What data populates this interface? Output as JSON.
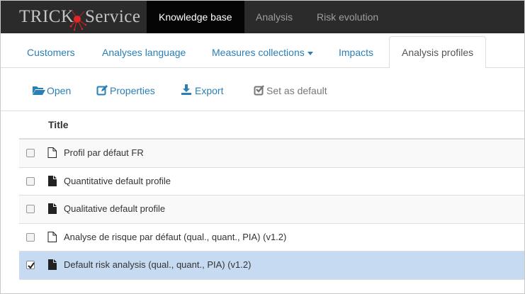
{
  "brand": {
    "name_part1": "TRICK",
    "name_part2": "Service"
  },
  "navbar": {
    "items": [
      {
        "label": "Knowledge base",
        "active": true
      },
      {
        "label": "Analysis",
        "active": false
      },
      {
        "label": "Risk evolution",
        "active": false
      }
    ]
  },
  "tabs": [
    {
      "label": "Customers"
    },
    {
      "label": "Analyses language"
    },
    {
      "label": "Measures collections"
    },
    {
      "label": "Impacts"
    },
    {
      "label": "Analysis profiles"
    }
  ],
  "toolbar": {
    "open_label": "Open",
    "properties_label": "Properties",
    "export_label": "Export",
    "set_default_label": "Set as default"
  },
  "table": {
    "header_title": "Title",
    "rows": [
      {
        "title": "Profil par défaut FR",
        "icon": "file-outline-icon",
        "checked": false
      },
      {
        "title": "Quantitative default profile",
        "icon": "file-solid-icon",
        "checked": false
      },
      {
        "title": "Qualitative default profile",
        "icon": "file-solid-icon",
        "checked": false
      },
      {
        "title": "Analyse de risque par défaut (qual., quant., PIA) (v1.2)",
        "icon": "file-outline-icon",
        "checked": false
      },
      {
        "title": "Default risk analysis (qual., quant., PIA) (v1.2)",
        "icon": "file-solid-icon",
        "checked": true
      }
    ]
  },
  "colors": {
    "navbar_bg": "#2b2b2b",
    "navbar_active_bg": "#050505",
    "link": "#2a7fb5",
    "selected_row": "#c6dbf1",
    "logo_red": "#d62424"
  }
}
